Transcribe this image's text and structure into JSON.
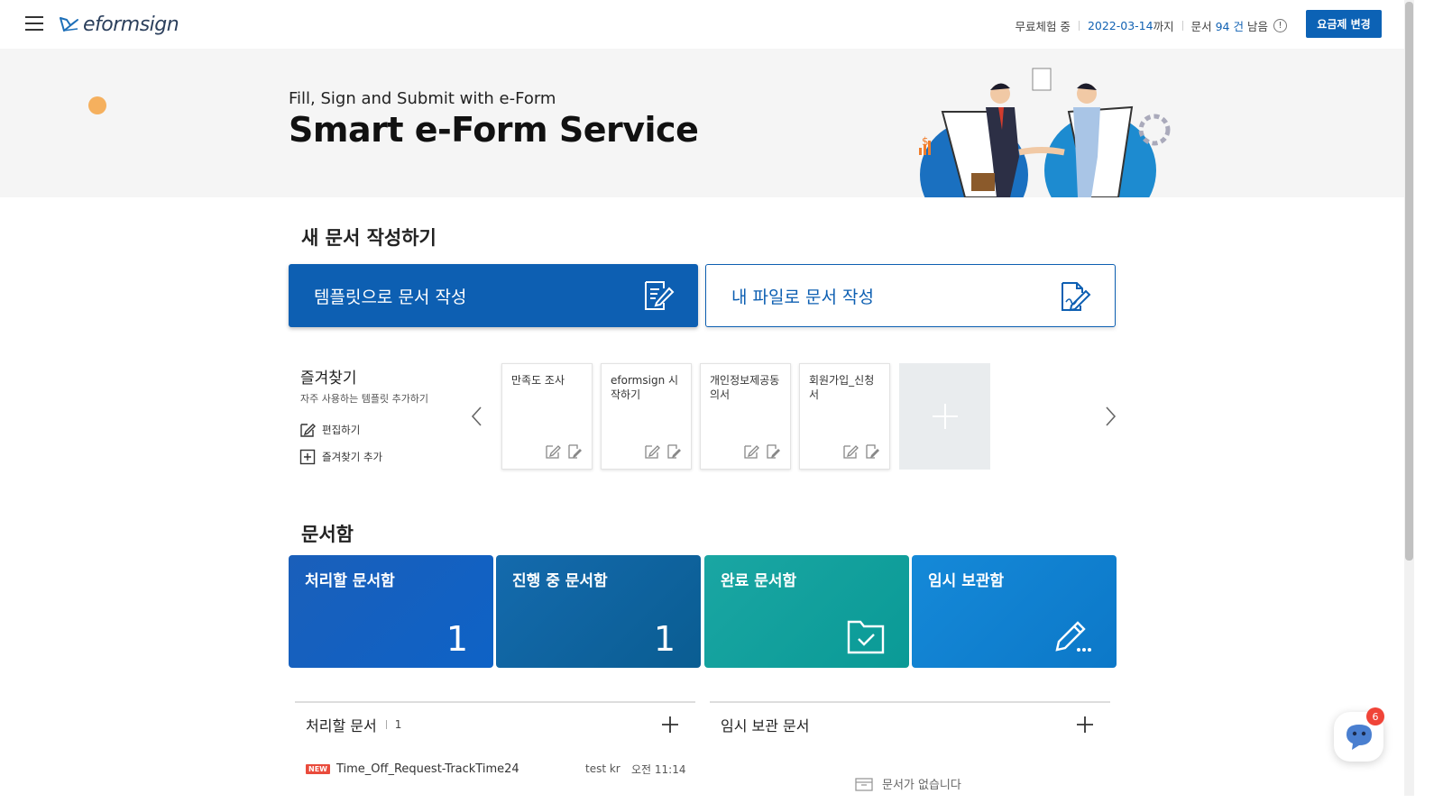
{
  "header": {
    "logo_text": "eformsign",
    "trial_status": "무료체험 중",
    "trial_date": "2022-03-14",
    "trial_until": "까지",
    "docs_label": "문서",
    "docs_count": "94 건",
    "docs_remaining": "남음",
    "info_glyph": "!",
    "plan_button": "요금제 변경"
  },
  "hero": {
    "subtitle": "Fill, Sign and Submit with e-Form",
    "title": "Smart e-Form Service",
    "illustration_symbol": "$"
  },
  "new_document": {
    "section_title": "새 문서 작성하기",
    "template_button": "템플릿으로 문서 작성",
    "file_button": "내 파일로 문서 작성"
  },
  "favorites": {
    "title": "즐겨찾기",
    "subtitle": "자주 사용하는 템플릿 추가하기",
    "edit_link": "편집하기",
    "add_link": "즐겨찾기 추가",
    "cards": [
      {
        "title": "만족도 조사"
      },
      {
        "title": "eformsign 시작하기"
      },
      {
        "title": "개인정보제공동의서"
      },
      {
        "title": "회원가입_신청서"
      }
    ]
  },
  "document_box": {
    "section_title": "문서함",
    "boxes": [
      {
        "label": "처리할 문서함",
        "count": "1"
      },
      {
        "label": "진행 중 문서함",
        "count": "1"
      },
      {
        "label": "완료 문서함",
        "icon": "folder-check-icon"
      },
      {
        "label": "임시 보관함",
        "icon": "pencil-icon"
      }
    ]
  },
  "todo_list": {
    "title": "처리할 문서",
    "count": "1",
    "rows": [
      {
        "badge": "NEW",
        "name": "Time_Off_Request-TrackTime24",
        "sender": "test kr",
        "time": "오전 11:14"
      }
    ]
  },
  "draft_list": {
    "title": "임시 보관 문서",
    "empty_text": "문서가 없습니다"
  },
  "chat": {
    "badge_count": "6"
  },
  "colors": {
    "primary": "#0d5fb2",
    "teal": "#0a9a96",
    "badge_red": "#e94b3c"
  }
}
